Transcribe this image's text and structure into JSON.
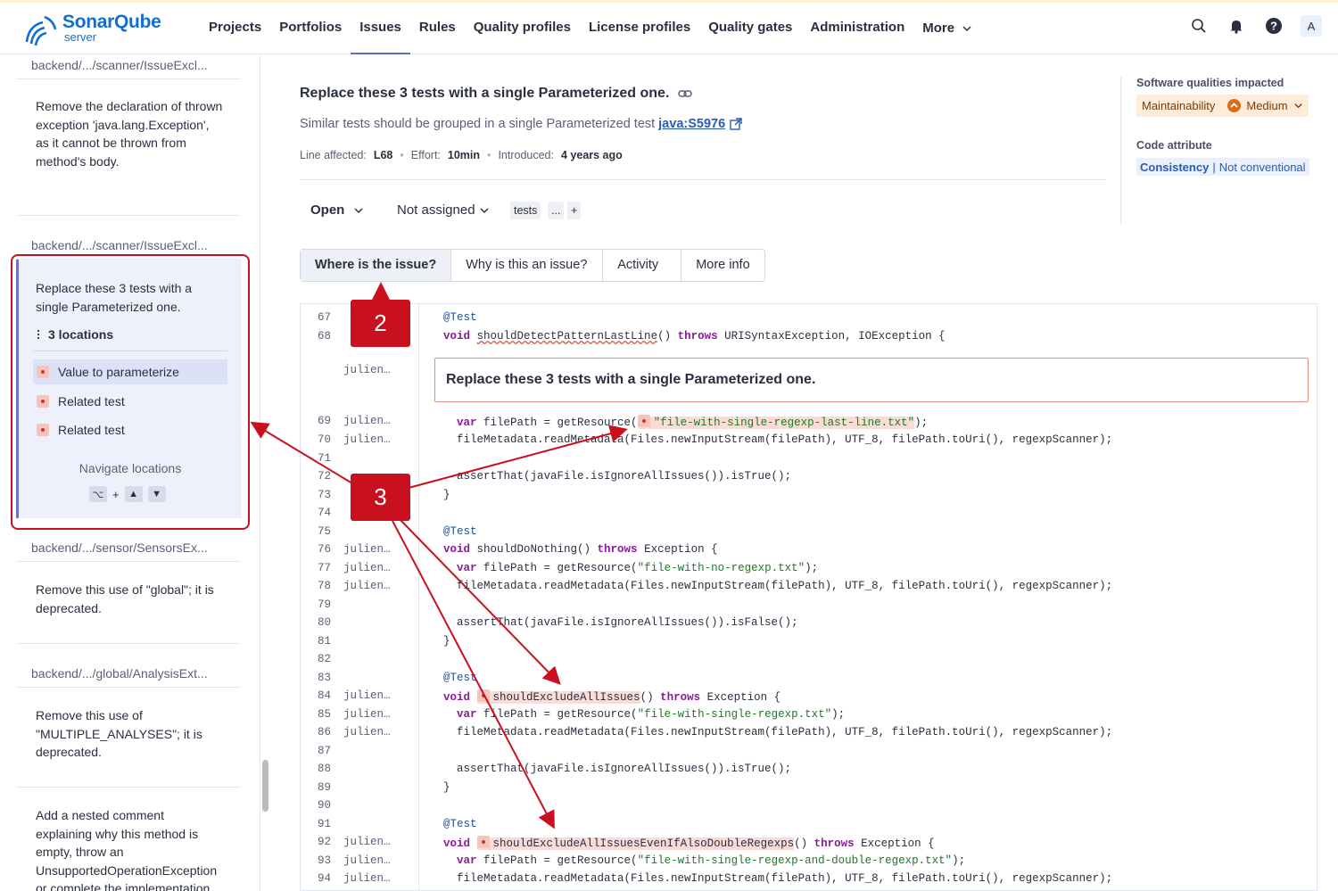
{
  "brand": {
    "name": "SonarQube",
    "sub": "server"
  },
  "nav": {
    "items": [
      "Projects",
      "Portfolios",
      "Issues",
      "Rules",
      "Quality profiles",
      "License profiles",
      "Quality gates",
      "Administration"
    ],
    "more": "More",
    "active": "Issues"
  },
  "user": {
    "avatar_letter": "A"
  },
  "sidebar": {
    "path1": "backend/.../scanner/IssueExcl...",
    "issue1": "Remove the declaration of thrown exception 'java.lang.Exception', as it cannot be thrown from method's body.",
    "path2": "backend/.../scanner/IssueExcl...",
    "selected": {
      "title": "Replace these 3 tests with a single Parameterized one.",
      "locations_count": "3 locations",
      "locations": [
        "Value to parameterize",
        "Related test",
        "Related test"
      ],
      "navigate_label": "Navigate locations",
      "key_modifier": "⌥",
      "key_plus": "+"
    },
    "path3": "backend/.../sensor/SensorsEx...",
    "issue3": "Remove this use of \"global\"; it is deprecated.",
    "path4": "backend/.../global/AnalysisExt...",
    "issue4": "Remove this use of \"MULTIPLE_ANALYSES\"; it is deprecated.",
    "issue5": "Add a nested comment explaining why this method is empty, throw an UnsupportedOperationException or complete the implementation."
  },
  "issue": {
    "title": "Replace these 3 tests with a single Parameterized one.",
    "subtitle": "Similar tests should be grouped in a single Parameterized test",
    "rule_key": "java:S5976",
    "line_label": "Line affected:",
    "line_value": "L68",
    "effort_label": "Effort:",
    "effort_value": "10min",
    "introduced_label": "Introduced:",
    "introduced_value": "4 years ago",
    "status": "Open",
    "assignee": "Not assigned",
    "tags": [
      "tests",
      "...",
      "+"
    ]
  },
  "tabs": [
    "Where is the issue?",
    "Why is this an issue?",
    "Activity",
    "More info"
  ],
  "right_panel": {
    "qualities_heading": "Software qualities impacted",
    "quality": "Maintainability",
    "severity": "Medium",
    "attribute_heading": "Code attribute",
    "attribute": "Consistency",
    "attribute_detail": "Not conventional"
  },
  "code": {
    "issue_message": "Replace these 3 tests with a single Parameterized one.",
    "blame_author": "julien…"
  },
  "callouts": {
    "a": "2",
    "b": "3"
  },
  "colors": {
    "accent": "#5d6cd0",
    "callout": "#c8101f",
    "issue_highlight": "#fadbd5"
  }
}
